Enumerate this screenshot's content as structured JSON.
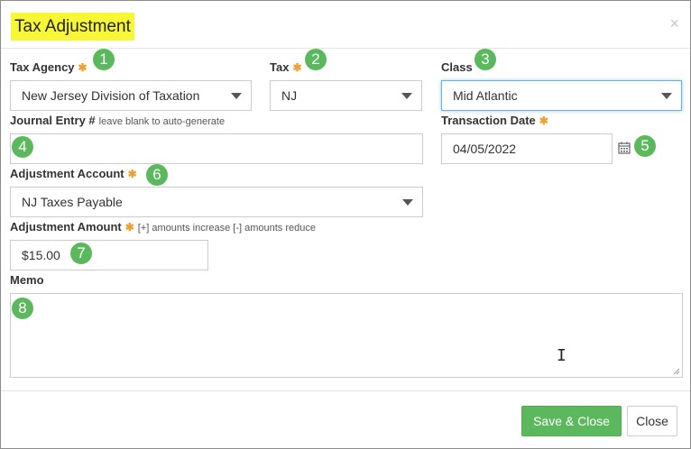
{
  "dialog": {
    "title": "Tax Adjustment",
    "close_glyph": "×"
  },
  "fields": {
    "tax_agency": {
      "label": "Tax Agency",
      "value": "New Jersey Division of Taxation",
      "badge": "1"
    },
    "tax": {
      "label": "Tax",
      "value": "NJ",
      "badge": "2"
    },
    "class": {
      "label": "Class",
      "value": "Mid Atlantic",
      "badge": "3"
    },
    "journal_entry": {
      "label": "Journal Entry #",
      "hint": "leave blank to auto-generate",
      "value": "",
      "badge": "4"
    },
    "transaction_date": {
      "label": "Transaction Date",
      "value": "04/05/2022",
      "badge": "5"
    },
    "adjustment_account": {
      "label": "Adjustment Account",
      "value": "NJ Taxes Payable",
      "badge": "6"
    },
    "adjustment_amount": {
      "label": "Adjustment Amount",
      "hint": "[+] amounts increase [-] amounts reduce",
      "value": "$15.00",
      "badge": "7"
    },
    "memo": {
      "label": "Memo",
      "value": "",
      "badge": "8"
    }
  },
  "required_mark": "✱",
  "buttons": {
    "save_close": "Save & Close",
    "close": "Close"
  },
  "colors": {
    "title_highlight": "#f7f736",
    "badge": "#5cb85c",
    "save_button": "#5cb85c",
    "required": "#f0a030",
    "focus": "#66afe9"
  },
  "icons": {
    "calendar": "calendar-icon",
    "close": "close-icon",
    "dropdown": "chevron-down-icon"
  }
}
